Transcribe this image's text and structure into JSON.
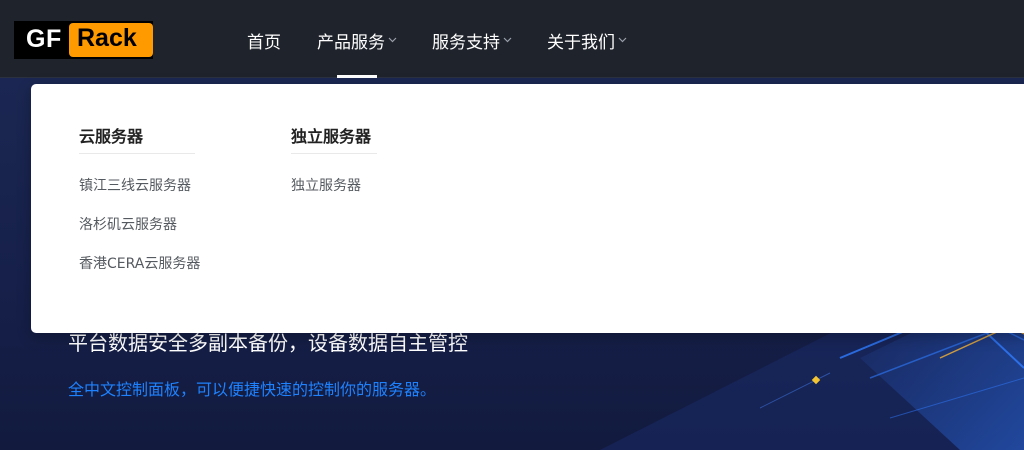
{
  "header": {
    "logo": {
      "part1": "GF",
      "part2": "Rack",
      "accent": "#ff9a00"
    },
    "nav": [
      {
        "label": "首页",
        "has_dropdown": false
      },
      {
        "label": "产品服务",
        "has_dropdown": true,
        "active": true
      },
      {
        "label": "服务支持",
        "has_dropdown": true
      },
      {
        "label": "关于我们",
        "has_dropdown": true
      }
    ]
  },
  "dropdown": {
    "columns": [
      {
        "title": "云服务器",
        "items": [
          "镇江三线云服务器",
          "洛杉矶云服务器",
          "香港CERA云服务器"
        ]
      },
      {
        "title": "独立服务器",
        "items": [
          "独立服务器"
        ]
      }
    ]
  },
  "hero": {
    "line1": "平台数据安全多副本备份，设备数据自主管控",
    "line2": "全中文控制面板，可以便捷快速的控制你的服务器。",
    "line2_color": "#1e82ff"
  }
}
